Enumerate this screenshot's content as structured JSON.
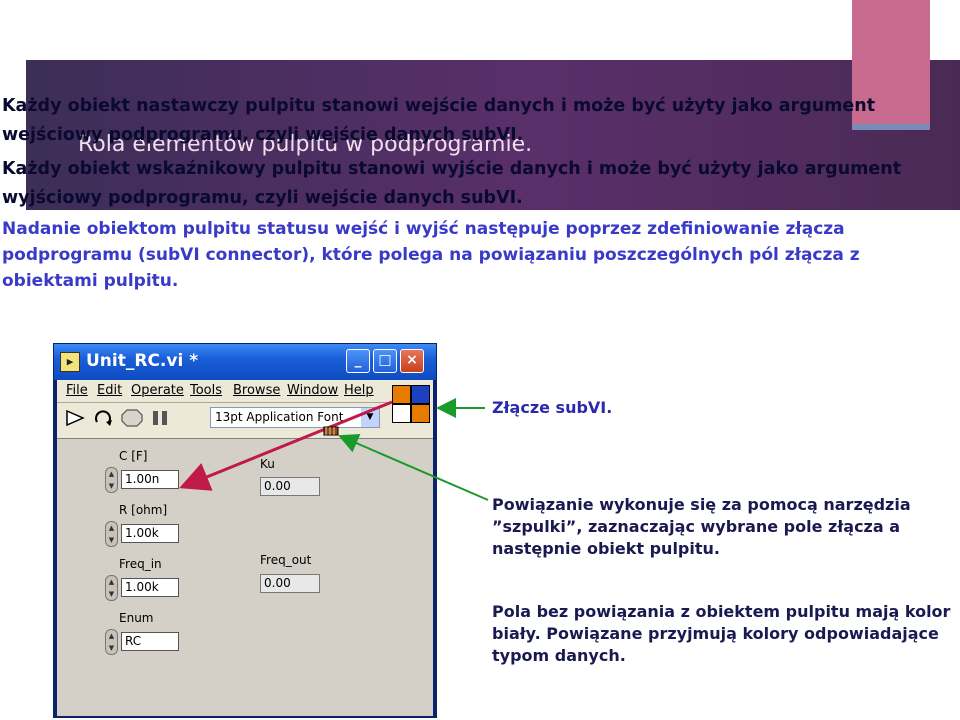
{
  "slide": {
    "title": "Rola elementów pulpitu w podprogramie.",
    "paragraph1": "Każdy obiekt nastawczy pulpitu stanowi wejście danych i może być użyty jako argument wejściowy podprogramu, czyli wejście danych subVI.",
    "paragraph2": "Każdy obiekt wskaźnikowy pulpitu stanowi wyjście danych i może być użyty jako argument wyjściowy podprogramu, czyli wejście danych subVI.",
    "paragraph3": "Nadanie obiektom pulpitu statusu wejść i wyjść następuje poprzez zdefiniowanie złącza podprogramu (subVI connector), które polega na powiązaniu poszczególnych pól złącza z obiektami pulpitu."
  },
  "window": {
    "title": "Unit_RC.vi *",
    "icon": "labview-vi-icon",
    "buttons": [
      "minimize",
      "maximize",
      "close"
    ],
    "menu": [
      "File",
      "Edit",
      "Operate",
      "Tools",
      "Browse",
      "Window",
      "Help"
    ],
    "font_selector": "13pt Application Font",
    "controls": [
      {
        "label": "C [F]",
        "value": "1.00n"
      },
      {
        "label": "R [ohm]",
        "value": "1.00k"
      },
      {
        "label": "Freq_in",
        "value": "1.00k"
      },
      {
        "label": "Enum",
        "value": "RC"
      }
    ],
    "indicators": [
      {
        "label": "Ku",
        "value": "0.00"
      },
      {
        "label": "Freq_out",
        "value": "0.00"
      }
    ],
    "connector_colors": [
      "#e87a00",
      "#1e3fbf",
      "#ffffff",
      "#e87a00"
    ]
  },
  "annotations": {
    "connector_label": "Złącze subVI.",
    "note1": "Powiązanie wykonuje się za pomocą narzędzia ”szpulki”, zaznaczając wybrane pole złącza a następnie obiekt pulpitu.",
    "note2": "Pola bez powiązania z obiektem pulpitu mają kolor biały. Powiązane przyjmują kolory odpowiadające typom danych."
  },
  "colors": {
    "banner": "#4a2d5e",
    "accent": "#c86b8e",
    "arrow_red": "#c01a4a",
    "arrow_green": "#1a9a2a",
    "highlight_text": "#3a3ac8"
  }
}
